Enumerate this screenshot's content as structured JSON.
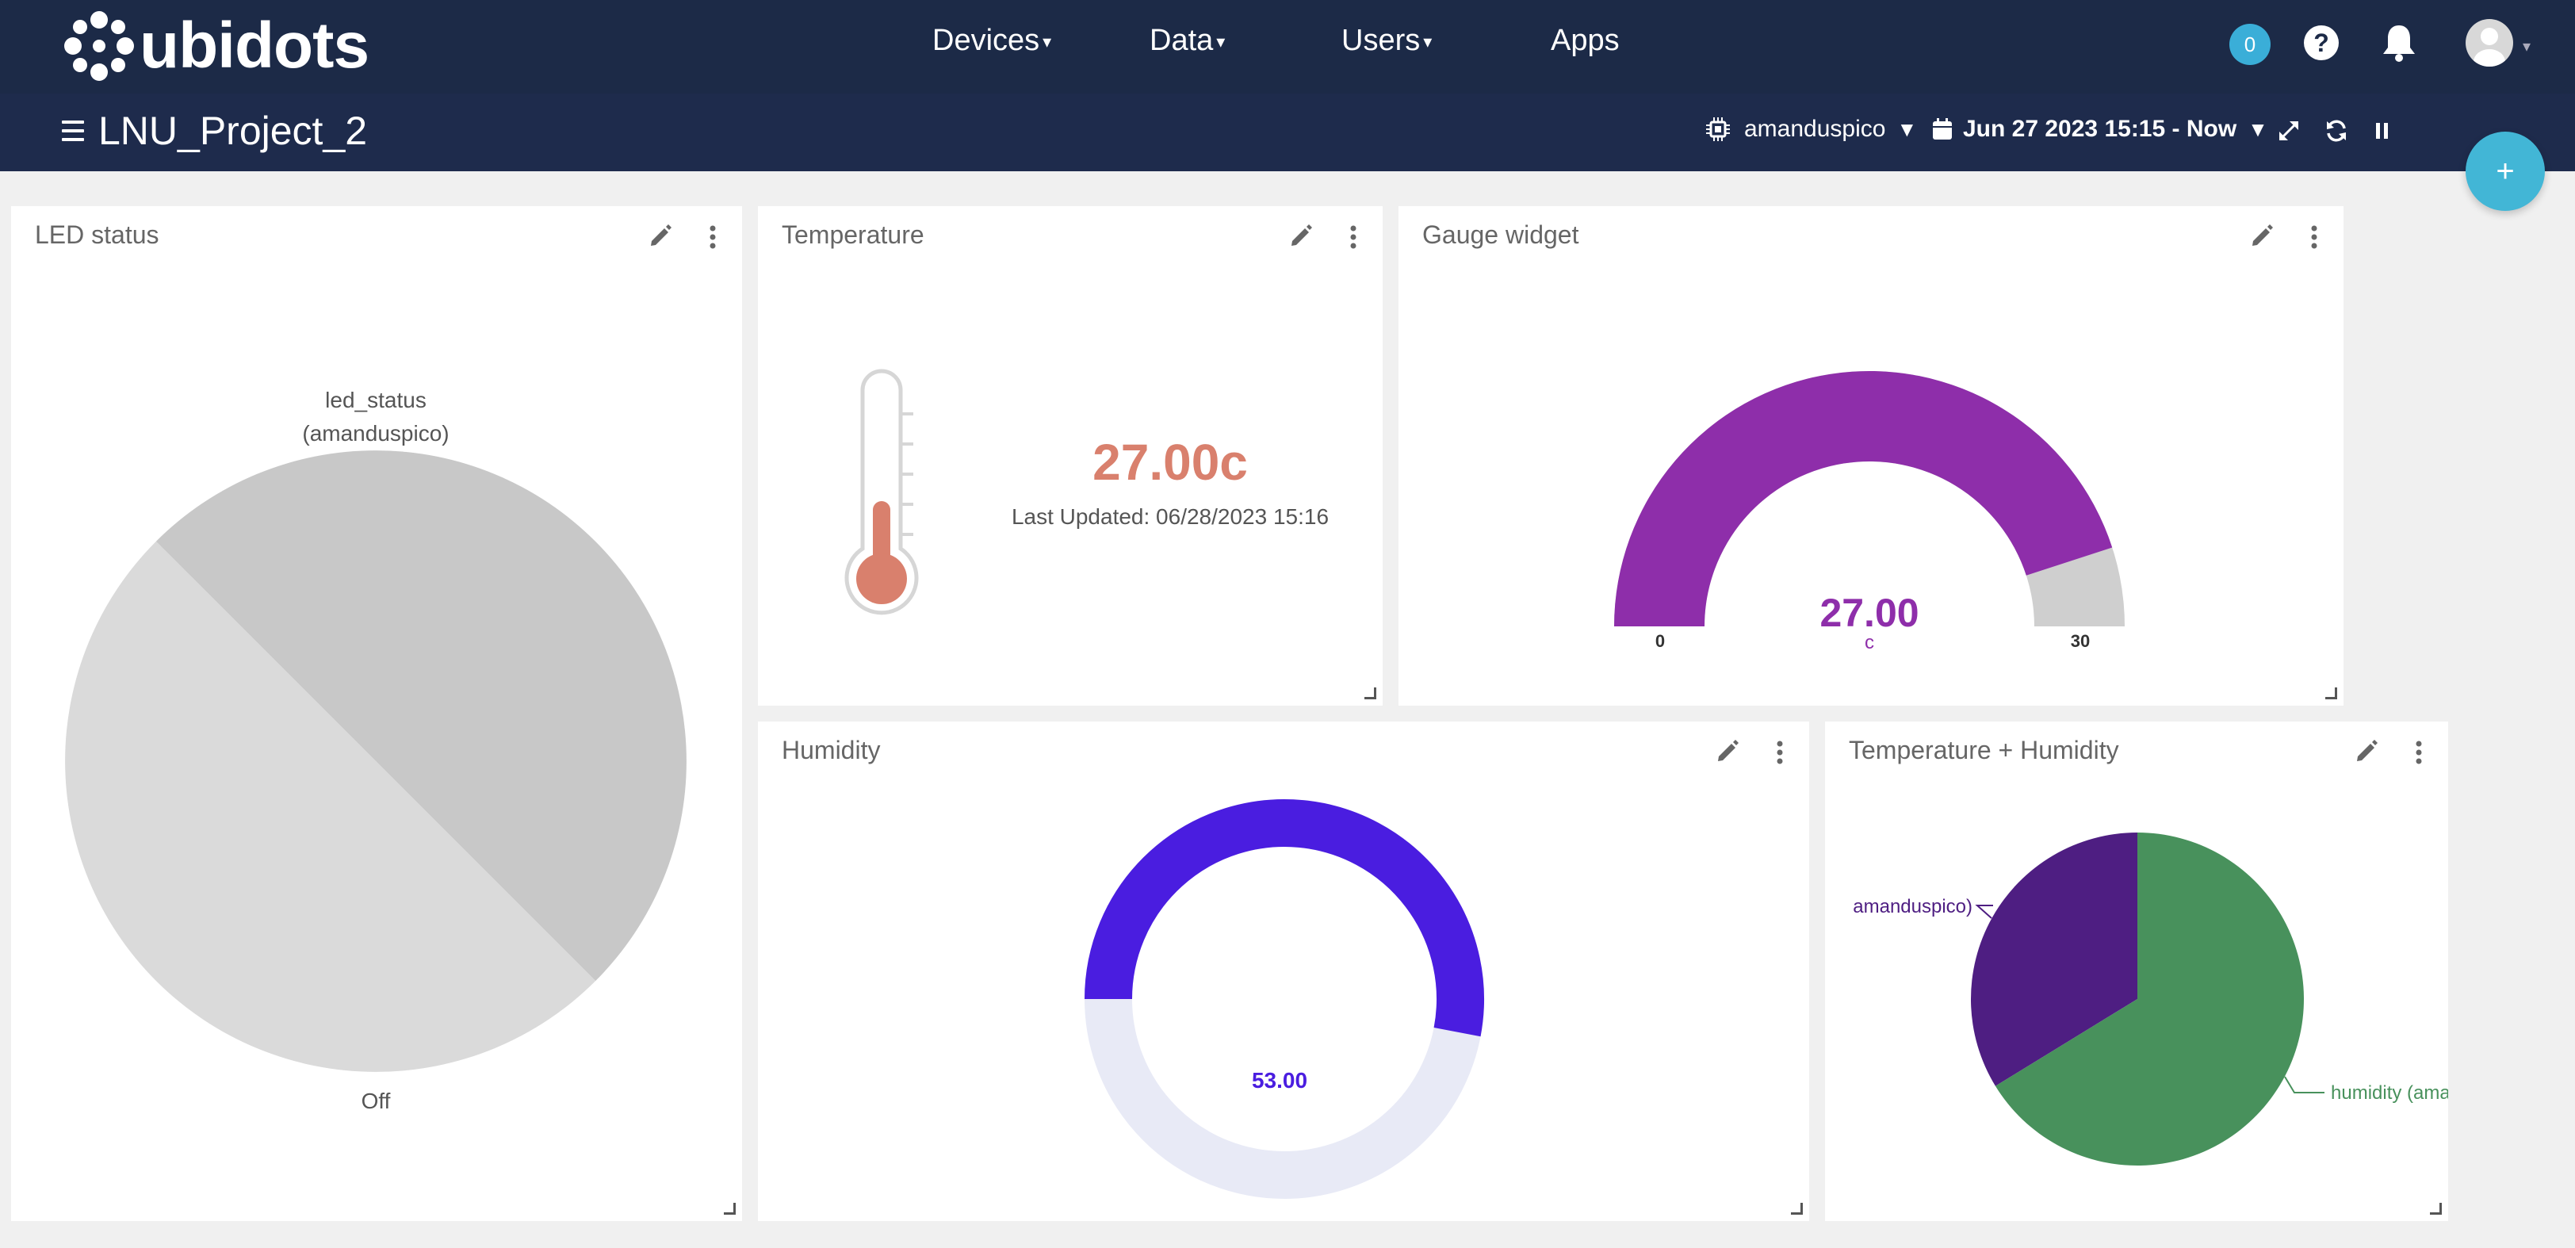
{
  "app": {
    "brand": "ubidots",
    "nav": [
      {
        "label": "Devices",
        "caret": true
      },
      {
        "label": "Data",
        "caret": true
      },
      {
        "label": "Users",
        "caret": true
      },
      {
        "label": "Apps",
        "caret": false
      }
    ],
    "notification_count": "0",
    "help_label": "?"
  },
  "dashboard": {
    "title": "LNU_Project_2",
    "device": "amanduspico",
    "date_range": "Jun 27 2023 15:15 - Now",
    "fab_label": "+"
  },
  "widgets": {
    "led": {
      "title": "LED status",
      "label_line1": "led_status",
      "label_line2": "(amanduspico)",
      "bottom_label": "Off"
    },
    "temperature": {
      "title": "Temperature",
      "value": "27.00c",
      "updated": "Last Updated: 06/28/2023 15:16",
      "level": 0.4
    },
    "gauge": {
      "title": "Gauge widget",
      "value": "27.00",
      "unit": "c",
      "min": "0",
      "max": "30",
      "fraction": 0.9
    },
    "humidity": {
      "title": "Humidity",
      "value": "53.00",
      "fraction": 0.53
    },
    "temp_hum": {
      "title": "Temperature + Humidity",
      "label_left": "amanduspico)",
      "label_right": "humidity (ama"
    }
  },
  "chart_data": [
    {
      "type": "pie",
      "title": "LED status",
      "categories": [
        "led_status (amanduspico)",
        "Off"
      ],
      "values": [
        50,
        50
      ],
      "colors": [
        "#c8c8c8",
        "#dadada"
      ]
    },
    {
      "type": "pie",
      "title": "Temperature + Humidity",
      "categories": [
        "temperature (amanduspico)",
        "humidity (amanduspico)"
      ],
      "values": [
        27,
        53
      ],
      "colors": [
        "#4e1e82",
        "#48915c"
      ]
    }
  ],
  "colors": {
    "topbar": "#1c2a47",
    "temp_red": "#d9806d",
    "gauge_purple": "#8e2eaa",
    "humidity_blue": "#4a1de0",
    "humidity_track": "#e8eaf6"
  }
}
